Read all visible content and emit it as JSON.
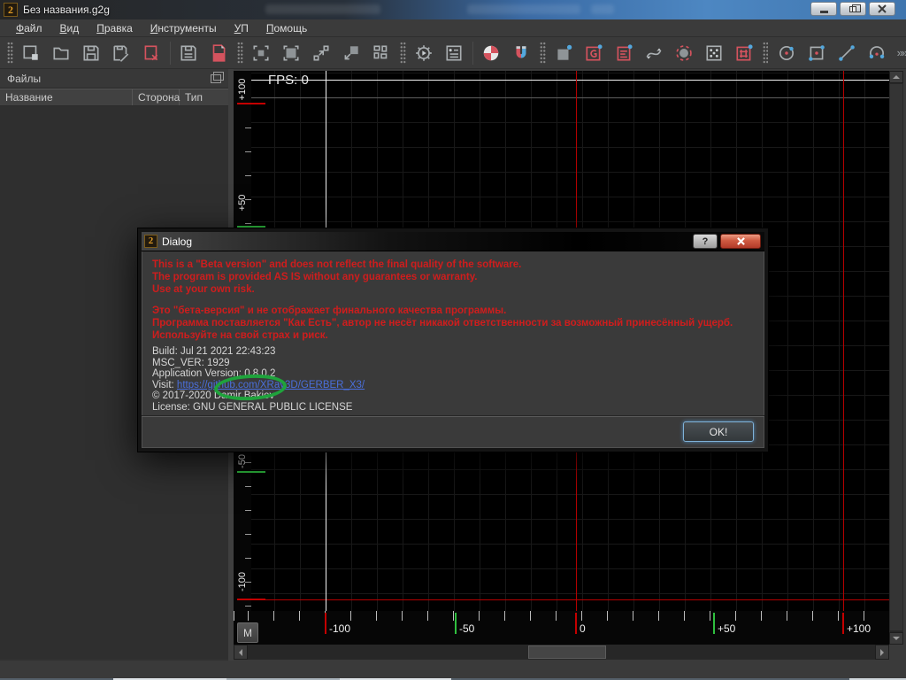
{
  "window": {
    "title": "Без названия.g2g"
  },
  "menu": {
    "items": [
      {
        "key": "Ф",
        "rest": "айл"
      },
      {
        "key": "В",
        "rest": "ид"
      },
      {
        "key": "П",
        "rest": "равка"
      },
      {
        "key": "И",
        "rest": "нструменты"
      },
      {
        "key": "У",
        "rest": "П"
      },
      {
        "key": "П",
        "rest": "омощь"
      }
    ]
  },
  "toolbar": {
    "icons": [
      "new-file",
      "open-file",
      "save",
      "save-as",
      "close-file",
      "save-project",
      "export-pdf",
      "zoom-fit",
      "zoom-selection",
      "zoom-out",
      "zoom-in",
      "markers",
      "gcode-settings",
      "properties",
      "datum-target",
      "snap-magnet",
      "rect-blank",
      "gerber-file",
      "excellon-file",
      "path-transform",
      "pocket-circle",
      "drill-holes",
      "thermal-mask",
      "circle-tool",
      "rect-tool",
      "line-tool",
      "arc-tool",
      "overflow"
    ]
  },
  "files_panel": {
    "title": "Файлы",
    "columns": [
      "Название",
      "Сторона",
      "Тип"
    ]
  },
  "canvas": {
    "fps": "FPS: 0",
    "m_button": "M",
    "h_ruler": {
      "labels": [
        "-100",
        "-50",
        "0",
        "+50",
        "+100"
      ]
    },
    "v_ruler": {
      "labels": [
        "+100",
        "+50",
        "-50",
        "-100"
      ]
    }
  },
  "dialog": {
    "title": "Dialog",
    "help_glyph": "?",
    "warning_en": [
      "This is a \"Beta version\" and does not reflect the final quality of the software.",
      "The program is provided AS IS without any guarantees or warranty.",
      "Use at your own risk."
    ],
    "warning_ru": [
      "Это \"бета-версия\" и не отображает финального качества программы.",
      "Программа поставляется \"Как Есть\", автор не несёт никакой ответственности за возможный принесённый ущерб.",
      "Используйте на свой страх и риск."
    ],
    "info": {
      "build": "Build: Jul 21 2021 22:43:23",
      "msc_ver": "MSC_VER: 1929",
      "version_label": "Application Version: ",
      "version": "0.8.0.2",
      "visit_label": "Visit: ",
      "visit_url": "https://github.com/XRay3D/GERBER_X3/",
      "copyright": "© 2017-2020 Damir Bakiev",
      "license": "License: GNU GENERAL PUBLIC LICENSE"
    },
    "ok_label": "OK!"
  },
  "colors": {
    "accent_red": "#d5535e",
    "accent_blue": "#53a7dc",
    "warning_red": "#cf1d1d",
    "link_blue": "#4a6fdc",
    "annotation_green": "#1fa33c",
    "axis_red": "#b40000",
    "titlebar_blue": "#4d87c2"
  }
}
